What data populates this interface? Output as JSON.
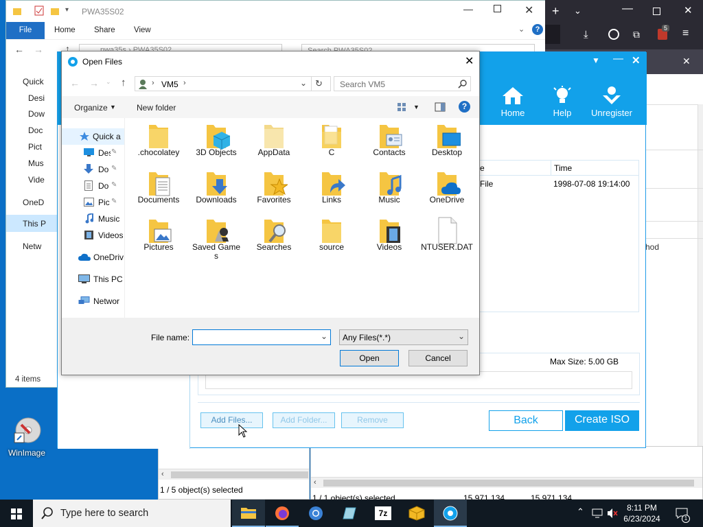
{
  "explorer": {
    "title": "PWA35S02",
    "ribbon": {
      "file": "File",
      "home": "Home",
      "share": "Share",
      "view": "View"
    },
    "address": "pwa35s  ›  PWA35S02",
    "search_placeholder": "Search PWA35S02",
    "sidebar": [
      "Quick",
      "Desi",
      "Dow",
      "Doc",
      "Pict",
      "Mus",
      "Vide",
      "OneD",
      "This P",
      "Netw"
    ],
    "status": "4 items"
  },
  "app": {
    "nav": [
      {
        "label": "Home",
        "icon": "home-icon"
      },
      {
        "label": "Help",
        "icon": "bulb-icon"
      },
      {
        "label": "Unregister",
        "icon": "user-icon"
      }
    ],
    "table": {
      "col_name": "e",
      "col_time": "Time",
      "row_name": "File",
      "row_time": "1998-07-08 19:14:00"
    },
    "side_text": "hod",
    "max_size": "Max Size: 5.00 GB",
    "buttons": {
      "add_files": "Add Files...",
      "add_folder": "Add Folder...",
      "remove": "Remove",
      "back": "Back",
      "create_iso": "Create ISO"
    }
  },
  "panes": {
    "left_status": "1 / 5 object(s) selected",
    "right_status": "1 / 1 object(s) selected",
    "size1": "15,971,134",
    "size2": "15,971,134"
  },
  "dialog": {
    "title": "Open Files",
    "breadcrumb": "VM5",
    "search_placeholder": "Search VM5",
    "toolbar": {
      "organize": "Organize",
      "new_folder": "New folder"
    },
    "nav": [
      {
        "label": "Quick a",
        "icon": "star-icon"
      },
      {
        "label": "Des",
        "icon": "desktop-icon"
      },
      {
        "label": "Do",
        "icon": "download-icon"
      },
      {
        "label": "Do",
        "icon": "document-icon"
      },
      {
        "label": "Pic",
        "icon": "picture-icon"
      },
      {
        "label": "Music",
        "icon": "music-icon"
      },
      {
        "label": "Videos",
        "icon": "video-icon"
      },
      {
        "label": "OneDriv",
        "icon": "cloud-icon"
      },
      {
        "label": "This PC",
        "icon": "pc-icon"
      },
      {
        "label": "Networ",
        "icon": "network-icon"
      }
    ],
    "items": [
      {
        "label": ".chocolatey",
        "kind": "folder"
      },
      {
        "label": "3D Objects",
        "kind": "folder-3d"
      },
      {
        "label": "AppData",
        "kind": "folder-light"
      },
      {
        "label": "C",
        "kind": "folder-doc"
      },
      {
        "label": "Contacts",
        "kind": "folder-contacts"
      },
      {
        "label": "Desktop",
        "kind": "folder-desktop"
      },
      {
        "label": "Documents",
        "kind": "folder-doc"
      },
      {
        "label": "Downloads",
        "kind": "folder-download"
      },
      {
        "label": "Favorites",
        "kind": "folder-star"
      },
      {
        "label": "Links",
        "kind": "folder-link"
      },
      {
        "label": "Music",
        "kind": "folder-music"
      },
      {
        "label": "OneDrive",
        "kind": "folder-cloud"
      },
      {
        "label": "Pictures",
        "kind": "folder-picture"
      },
      {
        "label": "Saved Games",
        "kind": "folder-games"
      },
      {
        "label": "Searches",
        "kind": "folder-search"
      },
      {
        "label": "source",
        "kind": "folder"
      },
      {
        "label": "Videos",
        "kind": "folder-video"
      },
      {
        "label": "NTUSER.DAT",
        "kind": "file"
      }
    ],
    "file_name_label": "File name:",
    "file_name_value": "",
    "file_type": "Any Files(*.*)",
    "open": "Open",
    "cancel": "Cancel"
  },
  "desktop": {
    "icon_label": "WinImage"
  },
  "taskbar": {
    "search_placeholder": "Type here to search",
    "time": "8:11 PM",
    "date": "6/23/2024",
    "notification_count": "1",
    "browser_badge": "5"
  },
  "colors": {
    "accent": "#12a1ea",
    "folder": "#f5c542",
    "taskbar": "#101922"
  }
}
